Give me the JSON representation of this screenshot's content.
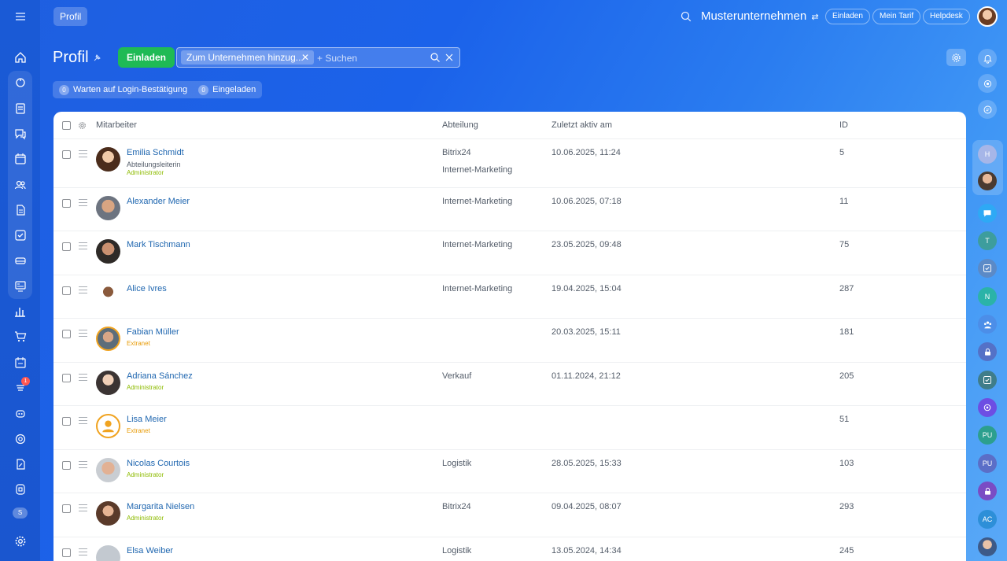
{
  "breadcrumb": "Profil",
  "company": "Musterunternehmen",
  "top_buttons": [
    "Einladen",
    "Mein Tarif",
    "Helpdesk"
  ],
  "page_title": "Profil",
  "invite_button": "Einladen",
  "filter": {
    "chip": "Zum Unternehmen hinzug...",
    "placeholder": "+ Suchen"
  },
  "counters": [
    {
      "count": "0",
      "label": "Warten auf Login-Bestätigung"
    },
    {
      "count": "0",
      "label": "Eingeladen"
    }
  ],
  "columns": {
    "employee": "Mitarbeiter",
    "department": "Abteilung",
    "last_active": "Zuletzt aktiv am",
    "id": "ID"
  },
  "left_rail": {
    "badge": "1",
    "initial": "S"
  },
  "right_rail": [
    "H",
    "T",
    "N",
    "PU",
    "PU",
    "AC"
  ],
  "rows": [
    {
      "name": "Emilia Schmidt",
      "position": "Abteilungsleiterin",
      "role": "Administrator",
      "role_type": "admin",
      "dept": "Bitrix24",
      "dept2": "Internet-Marketing",
      "last": "10.06.2025, 11:24",
      "id": "5"
    },
    {
      "name": "Alexander Meier",
      "position": "",
      "role": "",
      "role_type": "",
      "dept": "Internet-Marketing",
      "dept2": "",
      "last": "10.06.2025, 07:18",
      "id": "11"
    },
    {
      "name": "Mark Tischmann",
      "position": "",
      "role": "",
      "role_type": "",
      "dept": "Internet-Marketing",
      "dept2": "",
      "last": "23.05.2025, 09:48",
      "id": "75"
    },
    {
      "name": "Alice Ivres",
      "position": "",
      "role": "",
      "role_type": "",
      "dept": "Internet-Marketing",
      "dept2": "",
      "last": "19.04.2025, 15:04",
      "id": "287"
    },
    {
      "name": "Fabian Müller",
      "position": "",
      "role": "Extranet",
      "role_type": "ext",
      "dept": "",
      "dept2": "",
      "last": "20.03.2025, 15:11",
      "id": "181"
    },
    {
      "name": "Adriana Sánchez",
      "position": "",
      "role": "Administrator",
      "role_type": "admin",
      "dept": "Verkauf",
      "dept2": "",
      "last": "01.11.2024, 21:12",
      "id": "205"
    },
    {
      "name": "Lisa Meier",
      "position": "",
      "role": "Extranet",
      "role_type": "ext",
      "dept": "",
      "dept2": "",
      "last": "",
      "id": "51"
    },
    {
      "name": "Nicolas Courtois",
      "position": "",
      "role": "Administrator",
      "role_type": "admin",
      "dept": "Logistik",
      "dept2": "",
      "last": "28.05.2025, 15:33",
      "id": "103"
    },
    {
      "name": "Margarita Nielsen",
      "position": "",
      "role": "Administrator",
      "role_type": "admin",
      "dept": "Bitrix24",
      "dept2": "",
      "last": "09.04.2025, 08:07",
      "id": "293"
    },
    {
      "name": "Elsa Weiber",
      "position": "",
      "role": "",
      "role_type": "",
      "dept": "Logistik",
      "dept2": "",
      "last": "13.05.2024, 14:34",
      "id": "245"
    }
  ]
}
